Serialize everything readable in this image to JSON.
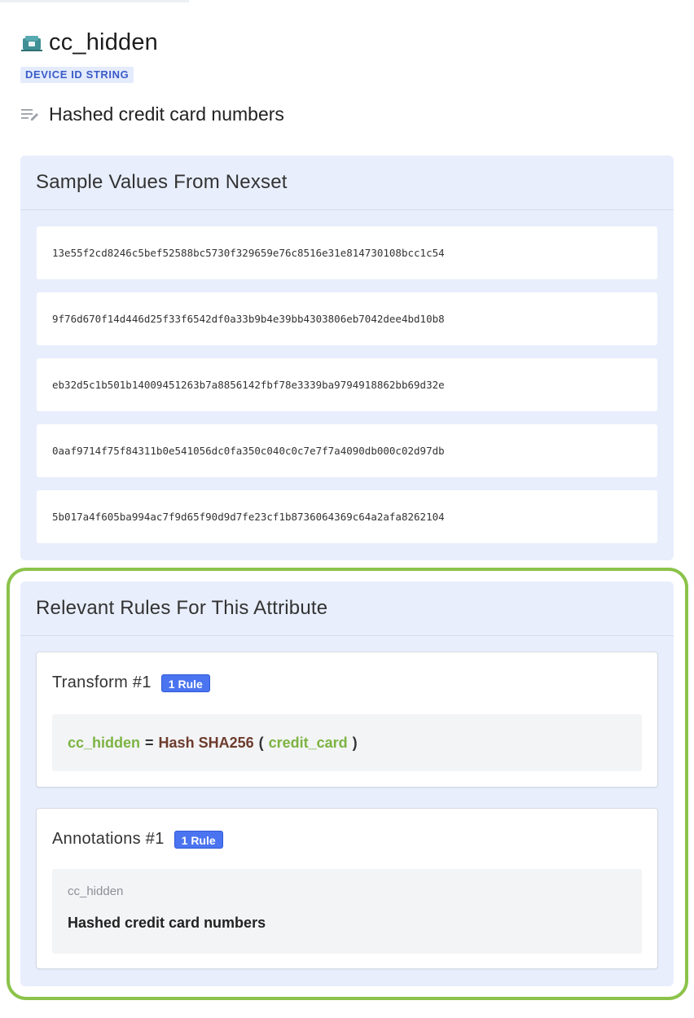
{
  "attribute": {
    "name": "cc_hidden",
    "type_badge": "DEVICE ID STRING",
    "description": "Hashed credit card numbers"
  },
  "samples": {
    "title": "Sample Values From Nexset",
    "values": [
      "13e55f2cd8246c5bef52588bc5730f329659e76c8516e31e814730108bcc1c54",
      "9f76d670f14d446d25f33f6542df0a33b9b4e39bb4303806eb7042dee4bd10b8",
      "eb32d5c1b501b14009451263b7a8856142fbf78e3339ba9794918862bb69d32e",
      "0aaf9714f75f84311b0e541056dc0fa350c040c0c7e7f7a4090db000c02d97db",
      "5b017a4f605ba994ac7f9d65f90d9d7fe23cf1b8736064369c64a2afa8262104"
    ]
  },
  "rules": {
    "title": "Relevant Rules For This Attribute",
    "transform": {
      "label": "Transform #1",
      "badge": "1 Rule",
      "target": "cc_hidden",
      "equals": "=",
      "function": "Hash SHA256",
      "open_paren": "(",
      "argument": "credit_card",
      "close_paren": ")"
    },
    "annotation": {
      "label": "Annotations #1",
      "badge": "1 Rule",
      "key": "cc_hidden",
      "value": "Hashed credit card numbers"
    }
  },
  "colors": {
    "highlight_border": "#8bc34a",
    "panel_bg": "#e8eefc",
    "badge_blue": "#4a74f0",
    "token_green": "#7cb342",
    "token_brown": "#6d3b2e"
  },
  "icons": {
    "attribute_icon": "device-id-icon",
    "description_icon": "notes-edit-icon"
  }
}
